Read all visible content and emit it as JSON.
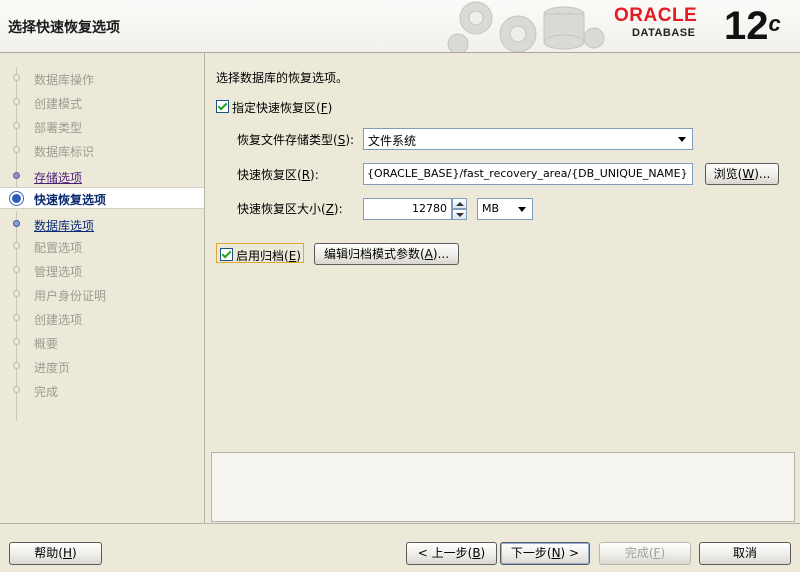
{
  "window": {
    "title": "选择快速恢复选项"
  },
  "logo": {
    "brand": "ORACLE",
    "product": "DATABASE",
    "version": "12",
    "version_suffix": "c"
  },
  "sidebar": {
    "steps": [
      {
        "label": "数据库操作",
        "state": "disabled"
      },
      {
        "label": "创建模式",
        "state": "disabled"
      },
      {
        "label": "部署类型",
        "state": "disabled"
      },
      {
        "label": "数据库标识",
        "state": "disabled"
      },
      {
        "label": "存储选项",
        "state": "done"
      },
      {
        "label": "快速恢复选项",
        "state": "current"
      },
      {
        "label": "数据库选项",
        "state": "next"
      },
      {
        "label": "配置选项",
        "state": "disabled"
      },
      {
        "label": "管理选项",
        "state": "disabled"
      },
      {
        "label": "用户身份证明",
        "state": "disabled"
      },
      {
        "label": "创建选项",
        "state": "disabled"
      },
      {
        "label": "概要",
        "state": "disabled"
      },
      {
        "label": "进度页",
        "state": "disabled"
      },
      {
        "label": "完成",
        "state": "disabled"
      }
    ]
  },
  "main": {
    "intro": "选择数据库的恢复选项。",
    "fra_checkbox_label": "指定快速恢复区(",
    "fra_checkbox_key": "F",
    "fra_checked": true,
    "storage_type_label": "恢复文件存储类型(",
    "storage_type_key": "S",
    "storage_type_value": "文件系统",
    "location_label": "快速恢复区(",
    "location_key": "R",
    "location_value": "{ORACLE_BASE}/fast_recovery_area/{DB_UNIQUE_NAME}",
    "browse_label": "浏览(",
    "browse_key": "W",
    "browse_suffix": ")...",
    "size_label": "快速恢复区大小(",
    "size_key": "Z",
    "size_value": "12780",
    "size_unit": "MB",
    "archive_label": "启用归档(",
    "archive_key": "E",
    "archive_checked": true,
    "edit_archive_label": "编辑归档模式参数(",
    "edit_archive_key": "A",
    "edit_archive_suffix": ")..."
  },
  "footer": {
    "help": {
      "label": "帮助(",
      "key": "H"
    },
    "back": {
      "label": "< 上一步(",
      "key": "B"
    },
    "next": {
      "label": "下一步(",
      "key": "N",
      "suffix": ") >"
    },
    "finish": {
      "label": "完成(",
      "key": "F"
    },
    "cancel": {
      "label": "取消"
    }
  },
  "colors": {
    "accent": "#2d5fb8",
    "brand_red": "#e31b23",
    "check_green": "#21a121"
  }
}
